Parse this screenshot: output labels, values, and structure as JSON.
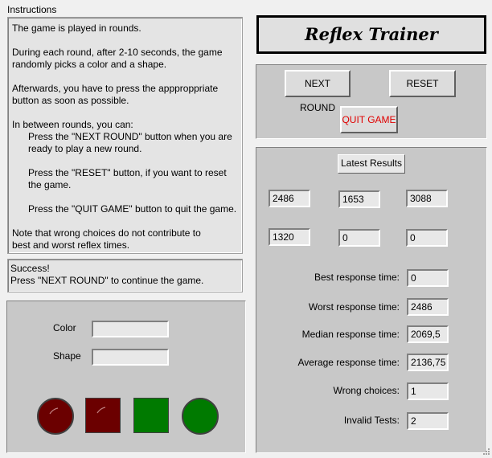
{
  "instructions": {
    "label": "Instructions",
    "lines": [
      "The game is played in rounds.",
      "",
      "During each round, after 2-10 seconds, the game",
      "randomly picks a color and a shape.",
      "",
      "Afterwards, you have to press the appproppriate",
      "button as soon as possible.",
      "",
      "In between rounds, you can:",
      "      Press the \"NEXT ROUND\" button when you are",
      "      ready to play a new round.",
      "",
      "      Press the \"RESET\" button, if you want to reset",
      "      the game.",
      "",
      "      Press the \"QUIT GAME\" button to quit the game.",
      "",
      "Note that wrong choices do not contribute to",
      "best and worst reflex times."
    ]
  },
  "status": {
    "line1": "Success!",
    "line2": "Press \"NEXT ROUND\" to continue the game."
  },
  "game": {
    "color_label": "Color",
    "shape_label": "Shape",
    "color_value": "",
    "shape_value": ""
  },
  "choices": {
    "colors": {
      "dark_red": "#6b0000",
      "green": "#007a00"
    }
  },
  "title": "Reflex Trainer",
  "buttons": {
    "next_round": "NEXT ROUND",
    "reset": "RESET",
    "quit": "QUIT GAME",
    "quit_color": "#e00000"
  },
  "results": {
    "header": "Latest Results",
    "values": [
      "2486",
      "1653",
      "3088",
      "1320",
      "0",
      "0"
    ]
  },
  "stats": {
    "best_label": "Best response time:",
    "best": "0",
    "worst_label": "Worst response time:",
    "worst": "2486",
    "median_label": "Median response time:",
    "median": "2069,5",
    "average_label": "Average response time:",
    "average": "2136,75",
    "wrong_label": "Wrong choices:",
    "wrong": "1",
    "invalid_label": "Invalid Tests:",
    "invalid": "2"
  }
}
